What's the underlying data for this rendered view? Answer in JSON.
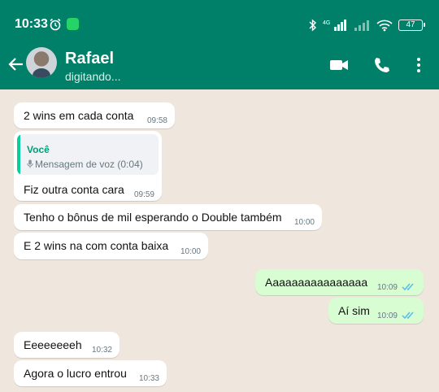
{
  "status_bar": {
    "time": "10:33",
    "battery": "47",
    "network": "4G"
  },
  "header": {
    "contact_name": "Rafael",
    "contact_status": "digitando..."
  },
  "messages": [
    {
      "text": "2 wins em cada conta",
      "time": "09:58"
    },
    {
      "quote_author": "Você",
      "quote_text": "Mensagem de voz (0:04)",
      "text": "Fiz outra conta cara",
      "time": "09:59"
    },
    {
      "text": "Tenho o bônus de mil esperando o Double também",
      "time": "10:00"
    },
    {
      "text": "E 2 wins na com conta baixa",
      "time": "10:00"
    },
    {
      "text": "Aaaaaaaaaaaaaaaa",
      "time": "10:09"
    },
    {
      "text": "Aí sim",
      "time": "10:09"
    },
    {
      "text": "Eeeeeeeeh",
      "time": "10:32"
    },
    {
      "text": "Agora o lucro entrou",
      "time": "10:33"
    }
  ],
  "colors": {
    "header": "#008069",
    "outgoing_bubble": "#d9fdd3",
    "incoming_bubble": "#ffffff",
    "wallpaper": "#efe7de",
    "read_ticks": "#53bdeb"
  }
}
